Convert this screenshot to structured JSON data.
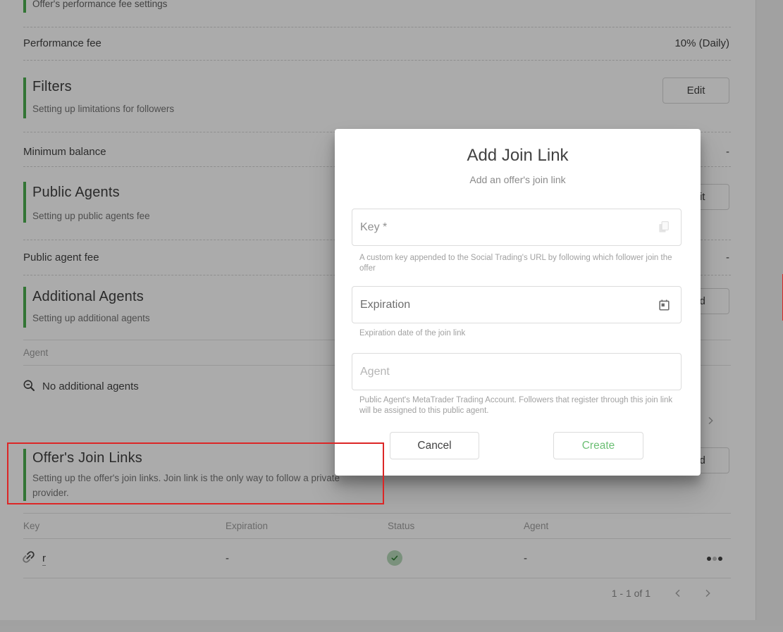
{
  "colors": {
    "accent_green": "#4caf50",
    "annotation_red": "#dc2626",
    "create_green": "#6cbf74",
    "status_green_bg": "#b7d9b9",
    "status_green_check": "#2e7d32"
  },
  "page": {
    "intro_subtitle": "Offer's performance fee settings",
    "performance_fee": {
      "label": "Performance fee",
      "value": "10% (Daily)"
    },
    "filters": {
      "title": "Filters",
      "subtitle": "Setting up limitations for followers",
      "button": "Edit"
    },
    "minimum_balance": {
      "label": "Minimum balance",
      "value": "-"
    },
    "public_agents": {
      "title": "Public Agents",
      "subtitle": "Setting up public agents fee",
      "button": "Edit"
    },
    "public_agent_fee": {
      "label": "Public agent fee",
      "value": "-"
    },
    "additional_agents": {
      "title": "Additional Agents",
      "subtitle": "Setting up additional agents",
      "button": "Add",
      "table": {
        "header": "Agent",
        "empty_text": "No additional agents"
      }
    },
    "join_links": {
      "title": "Offer's Join Links",
      "subtitle": "Setting up the offer's join links. Join link is the only way to follow a private provider.",
      "button": "Add",
      "table": {
        "headers": [
          "Key",
          "Expiration",
          "Status",
          "Agent"
        ],
        "row": {
          "key": "r",
          "expiration": "-",
          "status": "active",
          "agent": "-"
        }
      },
      "pagination": {
        "range": "1 - 1 of 1"
      }
    }
  },
  "modal": {
    "title": "Add Join Link",
    "subtitle": "Add an offer's join link",
    "fields": [
      {
        "label": "Key *",
        "icon": "copy-icon",
        "helper": "A custom key appended to the Social Trading's URL by following which follower join the offer"
      },
      {
        "label": "Expiration",
        "icon": "calendar-icon",
        "helper": "Expiration date of the join link"
      },
      {
        "label": "Agent",
        "icon": null,
        "helper": "Public Agent's MetaTrader Trading Account. Followers that register through this join link will be assigned to this public agent."
      }
    ],
    "cancel_label": "Cancel",
    "create_label": "Create"
  }
}
